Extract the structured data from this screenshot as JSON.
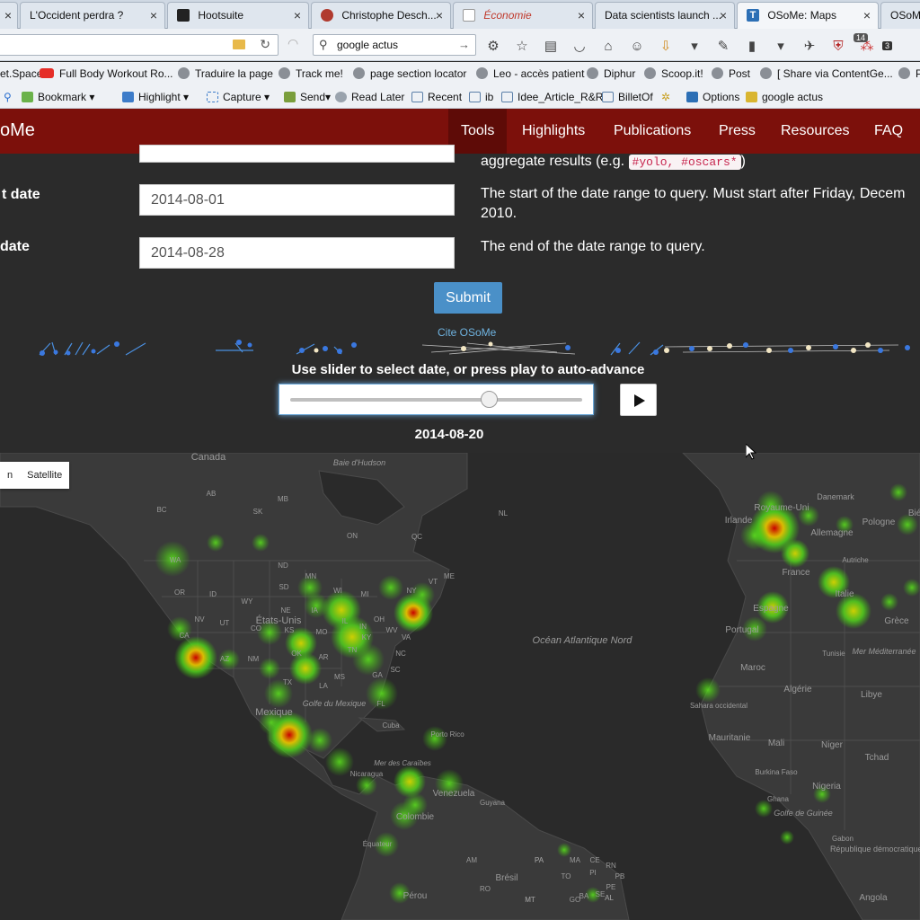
{
  "browser": {
    "tabs": [
      {
        "title": "L'Occident perdra ?",
        "close": "×"
      },
      {
        "title": "Hootsuite",
        "close": "×"
      },
      {
        "title": "Christophe Desch...",
        "close": "×"
      },
      {
        "title": "Économie",
        "close": "×"
      },
      {
        "title": "Data scientists launch ...",
        "close": "×"
      },
      {
        "title": "OSoMe: Maps",
        "close": "×"
      },
      {
        "title": "OSoMe",
        "close": ""
      }
    ],
    "tab_close_first": "×",
    "search_value": "google actus",
    "icons": [
      "folder-icon",
      "reload-icon",
      "rss-icon",
      "search-icon",
      "star-icon",
      "reader-icon",
      "pocket-icon",
      "home-icon",
      "emoji-icon",
      "download-icon",
      "menu-icon"
    ],
    "badges": {
      "addon1": "14",
      "addon2": "3"
    },
    "bookmarks": [
      "et.Space",
      "Full Body Workout Ro...",
      "Traduire la page",
      "Track me!",
      "page section locator",
      "Leo - accès patient",
      "Diphur",
      "Scoop.it!",
      "Post",
      "[ Share via ContentGe...",
      "P"
    ],
    "toolbar2": [
      "Bookmark",
      "Highlight",
      "Capture",
      "Send",
      "Read Later",
      "Recent",
      "ib",
      "Idee_Article_R&R",
      "BilletOf",
      "Options",
      "google  actus"
    ]
  },
  "site": {
    "brand": "oMe",
    "menu": [
      "Tools",
      "Highlights",
      "Publications",
      "Press",
      "Resources",
      "FAQ"
    ],
    "active_menu": "Tools",
    "form": {
      "hashtag_help_prefix": "aggregate results (e.g. ",
      "hashtag_help_code": "#yolo, #oscars*",
      "hashtag_help_suffix": ")",
      "start_label": "t date",
      "start_value": "2014-08-01",
      "start_help_line1": "The start of the date range to query. Must start after Friday, Decem",
      "start_help_line2": "2010.",
      "end_label": "date",
      "end_value": "2014-08-28",
      "end_help": "The end of the date range to query.",
      "submit": "Submit",
      "cite": "Cite OSoMe"
    },
    "slider": {
      "caption": "Use slider to select date, or press play to auto-advance",
      "position": 0.68,
      "date": "2014-08-20"
    },
    "map": {
      "type_buttons": [
        "n",
        "Satellite"
      ],
      "labels": [
        "Canada",
        "Baie d'Hudson",
        "AB",
        "SK",
        "MB",
        "ON",
        "QC",
        "NL",
        "BC",
        "MT",
        "ND",
        "MN",
        "WA",
        "OR",
        "ID",
        "WY",
        "SD",
        "NE",
        "IA",
        "WI",
        "MI",
        "NV",
        "UT",
        "CO",
        "KS",
        "MO",
        "IL",
        "IN",
        "OH",
        "PA",
        "NY",
        "VT",
        "ME",
        "CA",
        "AZ",
        "NM",
        "OK",
        "AR",
        "TN",
        "KY",
        "WV",
        "VA",
        "NC",
        "SC",
        "GA",
        "AL",
        "MS",
        "LA",
        "TX",
        "FL",
        "États-Unis",
        "Golfe du Mexique",
        "Mexique",
        "Cuba",
        "Porto Rico",
        "Mer des Caraïbes",
        "Nicaragua",
        "Venezuela",
        "Guyana",
        "Colombie",
        "Équateur",
        "Pérou",
        "Brésil",
        "AM",
        "PA",
        "MA",
        "CE",
        "RN",
        "PB",
        "PE",
        "AL",
        "SE",
        "BA",
        "TO",
        "PI",
        "RO",
        "MT",
        "GO",
        "Océan Atlantique Nord",
        "Danemark",
        "Royaume-Uni",
        "Irlande",
        "Pologne",
        "Allemagne",
        "Biélo",
        "Autriche",
        "France",
        "Italie",
        "Grèce",
        "Espagne",
        "Portugal",
        "Tunisie",
        "Mer Méditerranée",
        "Maroc",
        "Algérie",
        "Libye",
        "Sahara occidental",
        "Mauritanie",
        "Mali",
        "Niger",
        "Tchad",
        "Burkina Faso",
        "Nigeria",
        "Ghana",
        "Golfe de Guinée",
        "Gabon",
        "République démocratique du Congo",
        "Angola"
      ]
    }
  }
}
